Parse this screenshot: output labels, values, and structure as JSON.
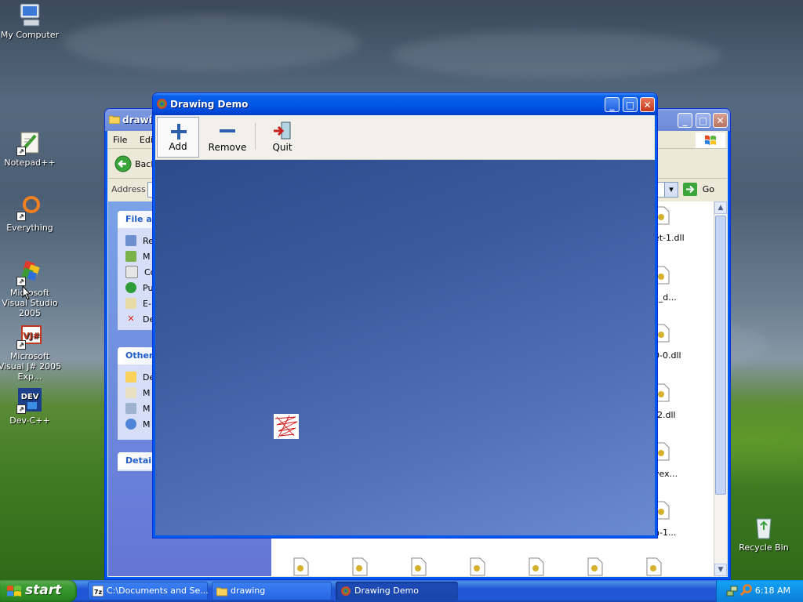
{
  "desktop": {
    "icons": [
      {
        "label": "My Computer",
        "icon": "my-computer-icon"
      },
      {
        "label": "Notepad++",
        "icon": "notepadpp-icon"
      },
      {
        "label": "Everything",
        "icon": "everything-icon"
      },
      {
        "label": "Microsoft Visual Studio 2005",
        "icon": "visual-studio-icon"
      },
      {
        "label": "Microsoft Visual J# 2005 Exp...",
        "icon": "visual-jsharp-icon"
      },
      {
        "label": "Dev-C++",
        "icon": "devcpp-icon"
      },
      {
        "label": "Recycle Bin",
        "icon": "recycle-bin-icon"
      }
    ]
  },
  "explorer": {
    "title": "drawi",
    "menu": [
      "File",
      "Edi"
    ],
    "back_label": "Back",
    "address_label": "Address",
    "go_label": "Go",
    "panels": [
      {
        "title": "File ar",
        "items": [
          "Re",
          "M",
          "Co",
          "Pu",
          "E-",
          "De"
        ]
      },
      {
        "title": "Other",
        "items": [
          "De",
          "M",
          "M",
          "M"
        ]
      },
      {
        "title": "Detail",
        "items": []
      }
    ],
    "file_labels": [
      "et-1.dll",
      "s_d...",
      "0-0.dll",
      "-2.dll",
      "vex...",
      "n-1..."
    ]
  },
  "drawing_demo": {
    "title": "Drawing Demo",
    "toolbar": {
      "add_label": "Add",
      "remove_label": "Remove",
      "quit_label": "Quit"
    },
    "canvas": {
      "sprite_count": 1,
      "background_colors": [
        "#2c4b8c",
        "#6a8ad2"
      ]
    }
  },
  "taskbar": {
    "start_label": "start",
    "tasks": [
      {
        "label": "C:\\Documents and Se...",
        "icon": "7zip-icon",
        "active": false
      },
      {
        "label": "drawing",
        "icon": "folder-icon",
        "active": false
      },
      {
        "label": "Drawing Demo",
        "icon": "drawing-demo-icon",
        "active": true
      }
    ],
    "clock": "6:18 AM"
  },
  "colors": {
    "xp_blue": "#0058e6",
    "start_green": "#3c9b32",
    "close_red": "#c4391c",
    "sprite_scribble": "#d01010"
  }
}
